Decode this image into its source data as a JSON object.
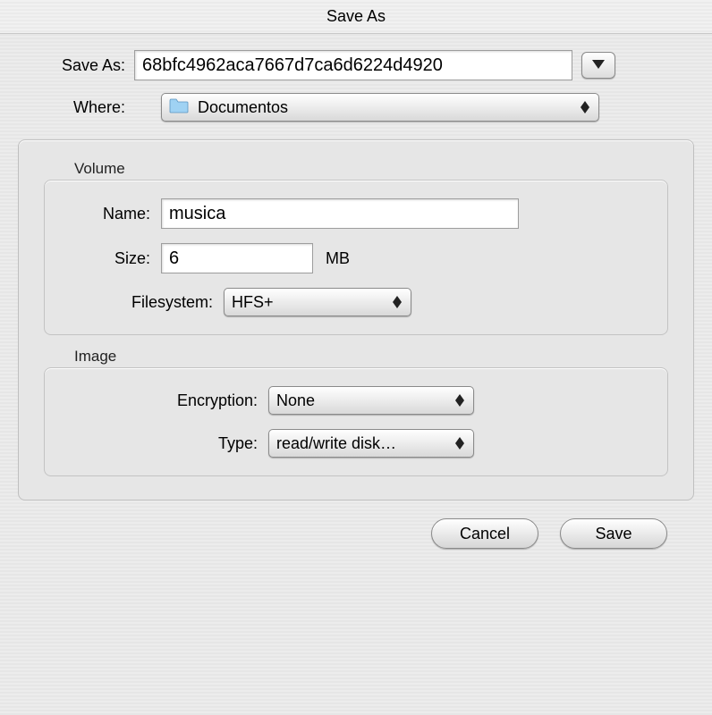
{
  "title": "Save As",
  "saveas": {
    "label": "Save As:",
    "filename": "68bfc4962aca7667d7ca6d6224d4920"
  },
  "where": {
    "label": "Where:",
    "folder": "Documentos"
  },
  "volume": {
    "group_label": "Volume",
    "name_label": "Name:",
    "name_value": "musica",
    "size_label": "Size:",
    "size_value": "6",
    "size_unit": "MB",
    "filesystem_label": "Filesystem:",
    "filesystem_value": "HFS+"
  },
  "image": {
    "group_label": "Image",
    "encryption_label": "Encryption:",
    "encryption_value": "None",
    "type_label": "Type:",
    "type_value": "read/write disk…"
  },
  "buttons": {
    "cancel": "Cancel",
    "save": "Save"
  }
}
